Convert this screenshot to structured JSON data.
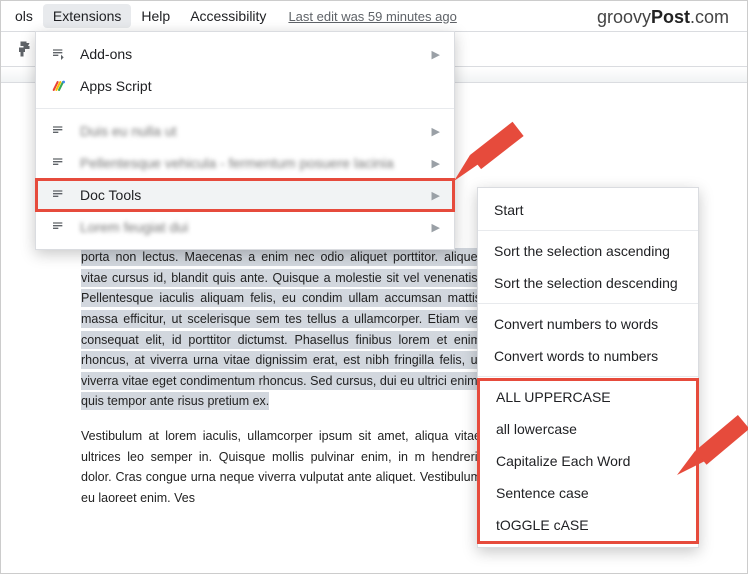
{
  "menubar": {
    "ols": "ols",
    "extensions": "Extensions",
    "help": "Help",
    "accessibility": "Accessibility",
    "lastedit": "Last edit was 59 minutes ago"
  },
  "brand": {
    "a": "groovy",
    "b": "Post",
    "c": ".com"
  },
  "menu": {
    "addons": "Add-ons",
    "appsscript": "Apps Script",
    "doctools": "Doc Tools",
    "blur1": "Duis eu nulla ut",
    "blur2": "Pellentesque vehicula - fermentum posuere lacinia",
    "blur3": "Lorem feugiat dui"
  },
  "submenu": {
    "start": "Start",
    "sortasc": "Sort the selection ascending",
    "sortdesc": "Sort the selection descending",
    "n2w": "Convert numbers to words",
    "w2n": "Convert words to numbers",
    "upper": "ALL UPPERCASE",
    "lower": "all lowercase",
    "capeach": "Capitalize Each Word",
    "sentence": "Sentence case",
    "toggle": "tOGGLE cASE"
  },
  "doc": {
    "sel": "porta non lectus. Maecenas a enim nec odio aliquet porttitor. aliquet vitae cursus id, blandit quis ante. Quisque a molestie sit vel venenatis. Pellentesque iaculis aliquam felis, eu condim ullam accumsan mattis massa efficitur, ut scelerisque sem tes tellus a ullamcorper. Etiam vel consequat elit, id porttitor dictumst. Phasellus finibus lorem et enim rhoncus, at viverra urna vitae dignissim erat, est nibh fringilla felis, ut viverra vitae eget condimentum rhoncus. Sed cursus, dui eu ultrici enim, quis tempor ante risus pretium ex.",
    "p2": "Vestibulum at lorem iaculis, ullamcorper ipsum sit amet, aliqua vitae ultrices leo semper in. Quisque mollis pulvinar enim, in m hendrerit dolor. Cras congue urna neque viverra vulputat ante aliquet. Vestibulum eu laoreet enim. Ves"
  }
}
